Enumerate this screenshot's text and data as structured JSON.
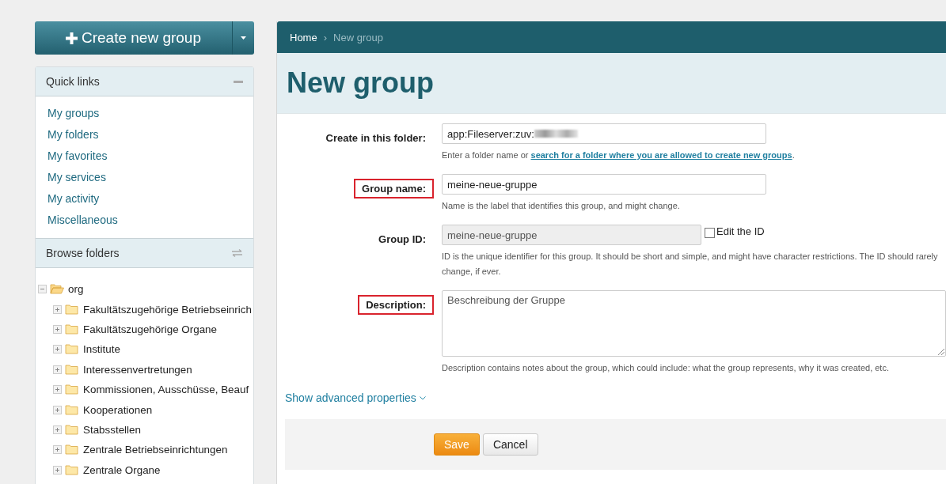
{
  "create_button": {
    "label": "Create new group"
  },
  "quick_links": {
    "title": "Quick links",
    "items": [
      "My groups",
      "My folders",
      "My favorites",
      "My services",
      "My activity",
      "Miscellaneous"
    ]
  },
  "browse_folders": {
    "title": "Browse folders",
    "tree": [
      {
        "label": "org",
        "expanded": true,
        "children": [
          {
            "label": "Fakultätszugehörige Betriebseinrich",
            "expanded": false
          },
          {
            "label": "Fakultätszugehörige Organe",
            "expanded": false
          },
          {
            "label": "Institute",
            "expanded": false
          },
          {
            "label": "Interessenvertretungen",
            "expanded": false
          },
          {
            "label": "Kommissionen, Ausschüsse, Beauf",
            "expanded": false
          },
          {
            "label": "Kooperationen",
            "expanded": false
          },
          {
            "label": "Stabsstellen",
            "expanded": false
          },
          {
            "label": "Zentrale Betriebseinrichtungen",
            "expanded": false
          },
          {
            "label": "Zentrale Organe",
            "expanded": false
          }
        ]
      }
    ]
  },
  "breadcrumb": [
    "Home",
    "New group"
  ],
  "breadcrumb_separator": "›",
  "page_title": "New group",
  "fields": [
    {
      "kind": "text",
      "label": "Create in this folder:",
      "value": "app:Fileserver:zuv:",
      "highlighted": false,
      "help": "Enter a folder name or ",
      "help_link": "search for a folder where you are allowed to create new groups",
      "help_end": "."
    },
    {
      "kind": "text",
      "label": "Group name:",
      "value": "meine-neue-gruppe",
      "highlighted": true,
      "help": "Name is the label that identifies this group, and might change."
    },
    {
      "kind": "readonly",
      "label": "Group ID:",
      "value": "meine-neue-gruppe",
      "highlighted": false,
      "checkbox": {
        "label": "Edit the ID",
        "checked": false
      },
      "help": "ID is the unique identifier for this group. It should be short and simple, and might have character restrictions. The ID should rarely change, if ever."
    },
    {
      "kind": "textarea",
      "label": "Description:",
      "value": "Beschreibung der Gruppe",
      "highlighted": true,
      "help": "Description contains notes about the group, which could include: what the group represents, why it was created, etc."
    }
  ],
  "advanced_link": "Show advanced properties",
  "buttons": [
    {
      "label": "Save",
      "kind": "primary"
    },
    {
      "label": "Cancel",
      "kind": "default"
    }
  ]
}
